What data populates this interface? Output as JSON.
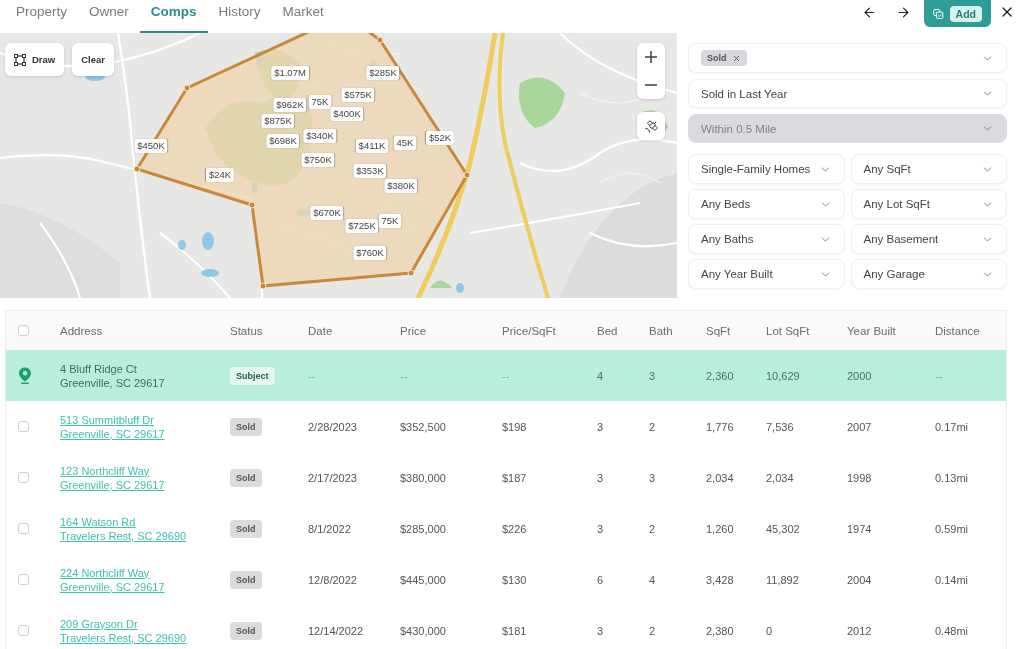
{
  "tabs": [
    {
      "label": "Property",
      "selected": false
    },
    {
      "label": "Owner",
      "selected": false
    },
    {
      "label": "Comps",
      "selected": true
    },
    {
      "label": "History",
      "selected": false
    },
    {
      "label": "Market",
      "selected": false
    }
  ],
  "toolbar": {
    "add_button": {
      "label": "Add"
    }
  },
  "map": {
    "tools": [
      {
        "kind": "draw",
        "label": "Draw"
      },
      {
        "kind": "clear",
        "label": "Clear"
      }
    ],
    "price_markers": [
      {
        "label": "$1.07M"
      },
      {
        "label": "$285K"
      },
      {
        "label": "$575K"
      },
      {
        "label": "$962K"
      },
      {
        "label": "75K"
      },
      {
        "label": "$400K"
      },
      {
        "label": "$875K"
      },
      {
        "label": "$698K"
      },
      {
        "label": "$340K"
      },
      {
        "label": "$411K"
      },
      {
        "label": "45K"
      },
      {
        "label": "$52K"
      },
      {
        "label": "$450K"
      },
      {
        "label": "$750K"
      },
      {
        "label": "$24K"
      },
      {
        "label": "$353K"
      },
      {
        "label": "$380K"
      },
      {
        "label": "$670K"
      },
      {
        "label": "$725K"
      },
      {
        "label": "75K"
      },
      {
        "label": "$760K"
      }
    ]
  },
  "filters": {
    "status": {
      "chips": [
        {
          "label": "Sold"
        }
      ]
    },
    "period": {
      "value": "Sold in Last Year",
      "disabled": false
    },
    "radius": {
      "value": "Within 0.5 Mile",
      "disabled": true
    },
    "options": [
      {
        "value": "Single-Family Homes"
      },
      {
        "value": "Any SqFt"
      },
      {
        "value": "Any Beds"
      },
      {
        "value": "Any Lot SqFt"
      },
      {
        "value": "Any Baths"
      },
      {
        "value": "Any Basement"
      },
      {
        "value": "Any Year Built"
      },
      {
        "value": "Any Garage"
      }
    ]
  },
  "table": {
    "select_all": {
      "checked": false
    },
    "columns": [
      "Address",
      "Status",
      "Date",
      "Price",
      "Price/SqFt",
      "Bed",
      "Bath",
      "SqFt",
      "Lot SqFt",
      "Year Built",
      "Distance"
    ],
    "rows": [
      {
        "kind": "subject",
        "street": "4 Bluff Ridge Ct",
        "city": "Greenville, SC 29617",
        "status": "Subject",
        "date": "--",
        "price": "--",
        "price_per_sqft": "--",
        "bed": "4",
        "bath": "3",
        "sqft": "2,360",
        "lot_sqft": "10,629",
        "year_built": "2000",
        "distance": "--"
      },
      {
        "kind": "comp",
        "checked": false,
        "street": "513 Summitbluff Dr",
        "city": "Greenville, SC 29617",
        "status": "Sold",
        "date": "2/28/2023",
        "price": "$352,500",
        "price_per_sqft": "$198",
        "bed": "3",
        "bath": "2",
        "sqft": "1,776",
        "lot_sqft": "7,536",
        "year_built": "2007",
        "distance": "0.17mi"
      },
      {
        "kind": "comp",
        "checked": false,
        "street": "123 Northcliff Way",
        "city": "Greenville, SC 29617",
        "status": "Sold",
        "date": "2/17/2023",
        "price": "$380,000",
        "price_per_sqft": "$187",
        "bed": "3",
        "bath": "3",
        "sqft": "2,034",
        "lot_sqft": "2,034",
        "year_built": "1998",
        "distance": "0.13mi"
      },
      {
        "kind": "comp",
        "checked": false,
        "street": "164 Watson Rd",
        "city": "Travelers Rest, SC 29690",
        "status": "Sold",
        "date": "8/1/2022",
        "price": "$285,000",
        "price_per_sqft": "$226",
        "bed": "3",
        "bath": "2",
        "sqft": "1,260",
        "lot_sqft": "45,302",
        "year_built": "1974",
        "distance": "0.59mi"
      },
      {
        "kind": "comp",
        "checked": false,
        "street": "224 Northcliff Way",
        "city": "Greenville, SC 29617",
        "status": "Sold",
        "date": "12/8/2022",
        "price": "$445,000",
        "price_per_sqft": "$130",
        "bed": "6",
        "bath": "4",
        "sqft": "3,428",
        "lot_sqft": "11,892",
        "year_built": "2004",
        "distance": "0.14mi"
      },
      {
        "kind": "comp",
        "checked": false,
        "street": "209 Grayson Dr",
        "city": "Travelers Rest, SC 29690",
        "status": "Sold",
        "date": "12/14/2022",
        "price": "$430,000",
        "price_per_sqft": "$181",
        "bed": "3",
        "bath": "2",
        "sqft": "2,380",
        "lot_sqft": "0",
        "year_built": "2012",
        "distance": "0.48mi"
      }
    ]
  }
}
